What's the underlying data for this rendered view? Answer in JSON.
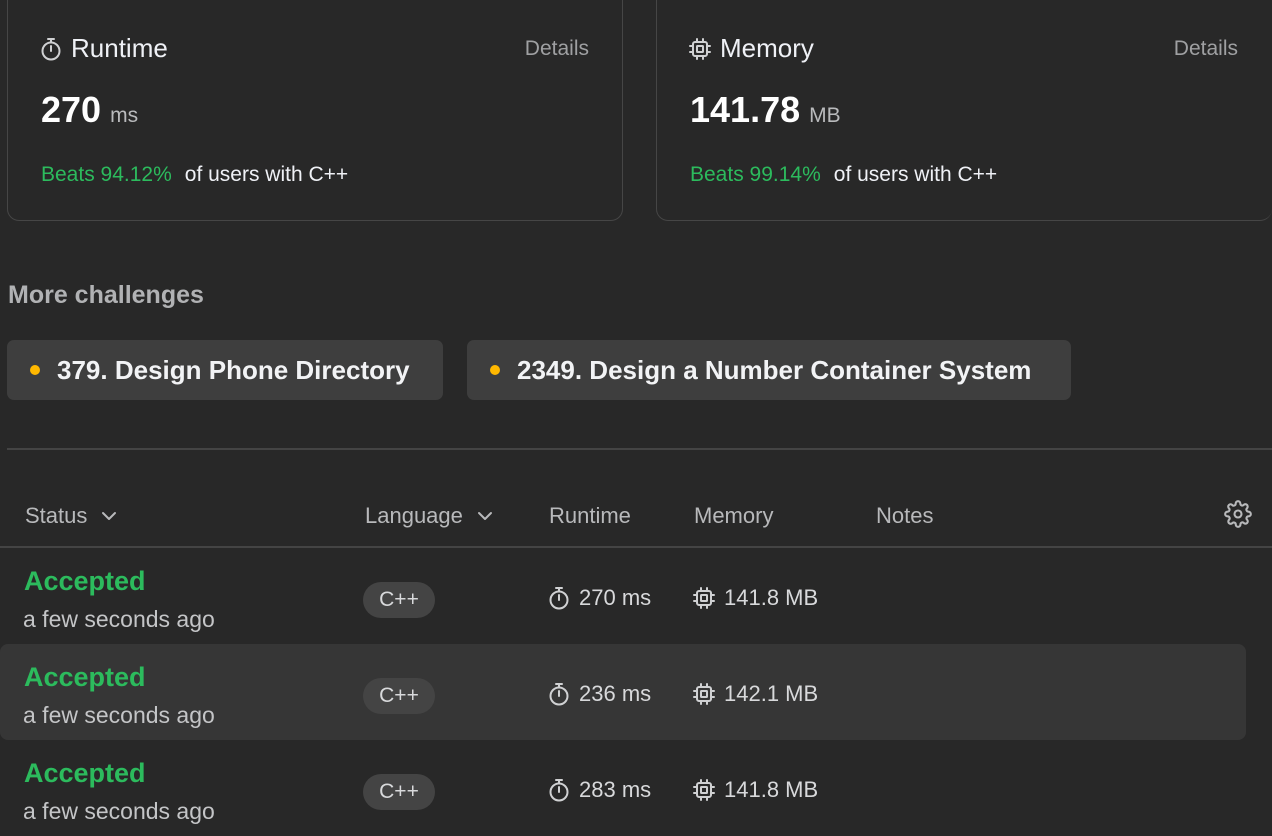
{
  "colors": {
    "accent_green": "#2cbb5d",
    "medium_dot": "#ffb800",
    "background": "#282828"
  },
  "runtime_card": {
    "icon": "stopwatch-icon",
    "title": "Runtime",
    "details_label": "Details",
    "value": "270",
    "unit": "ms",
    "beats": "Beats 94.12%",
    "beats_suffix": "of users with C++"
  },
  "memory_card": {
    "icon": "chip-icon",
    "title": "Memory",
    "details_label": "Details",
    "value": "141.78",
    "unit": "MB",
    "beats": "Beats 99.14%",
    "beats_suffix": "of users with C++"
  },
  "more_challenges": {
    "title": "More challenges",
    "items": [
      {
        "label": "379. Design Phone Directory"
      },
      {
        "label": "2349. Design a Number Container System"
      }
    ]
  },
  "table": {
    "headers": {
      "status": "Status",
      "language": "Language",
      "runtime": "Runtime",
      "memory": "Memory",
      "notes": "Notes"
    },
    "rows": [
      {
        "status": "Accepted",
        "time": "a few seconds ago",
        "language": "C++",
        "runtime": "270 ms",
        "memory": "141.8 MB"
      },
      {
        "status": "Accepted",
        "time": "a few seconds ago",
        "language": "C++",
        "runtime": "236 ms",
        "memory": "142.1 MB"
      },
      {
        "status": "Accepted",
        "time": "a few seconds ago",
        "language": "C++",
        "runtime": "283 ms",
        "memory": "141.8 MB"
      }
    ]
  }
}
